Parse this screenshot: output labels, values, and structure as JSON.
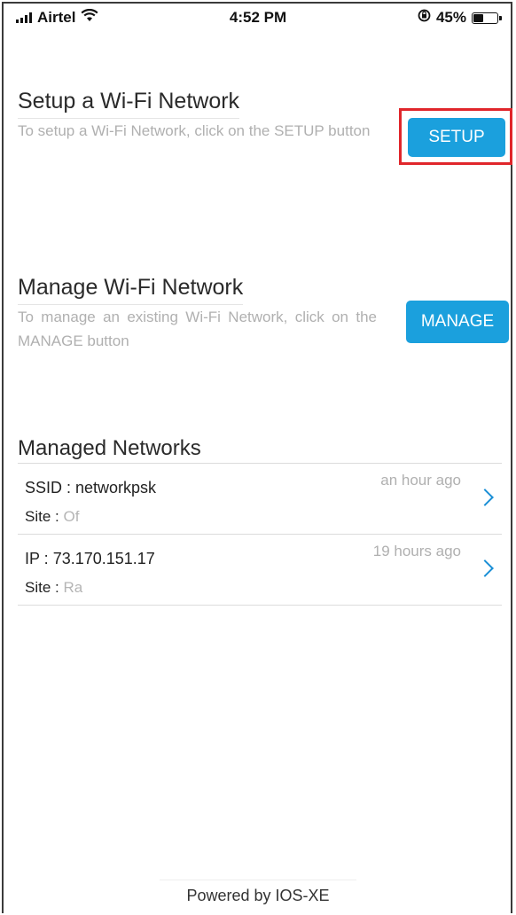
{
  "status_bar": {
    "carrier": "Airtel",
    "time": "4:52 PM",
    "battery_percent_label": "45%",
    "battery_level": 0.45,
    "icons": [
      "signal-bars-icon",
      "wifi-icon",
      "orientation-lock-icon",
      "battery-icon"
    ]
  },
  "setup": {
    "title": "Setup a Wi-Fi Network",
    "description": "To setup a Wi-Fi Network, click on the SETUP button",
    "button_label": "SETUP"
  },
  "manage": {
    "title": "Manage Wi-Fi Network",
    "description": "To manage an existing Wi-Fi Network, click on the MANAGE button",
    "button_label": "MANAGE"
  },
  "managed_networks": {
    "title": "Managed Networks",
    "items": [
      {
        "key": "SSID : ",
        "value": "networkpsk",
        "site_label": "Site : ",
        "site_value": "Of",
        "time": "an hour ago"
      },
      {
        "key": "IP : ",
        "value": "73.170.151.17",
        "site_label": "Site : ",
        "site_value": "Ra",
        "time": "19 hours ago"
      }
    ]
  },
  "footer": {
    "text": "Powered by IOS-XE"
  },
  "colors": {
    "accent": "#1ba0dd",
    "highlight": "#e0262b",
    "muted_text": "#b0b0b0",
    "chevron": "#1a8fd6"
  }
}
